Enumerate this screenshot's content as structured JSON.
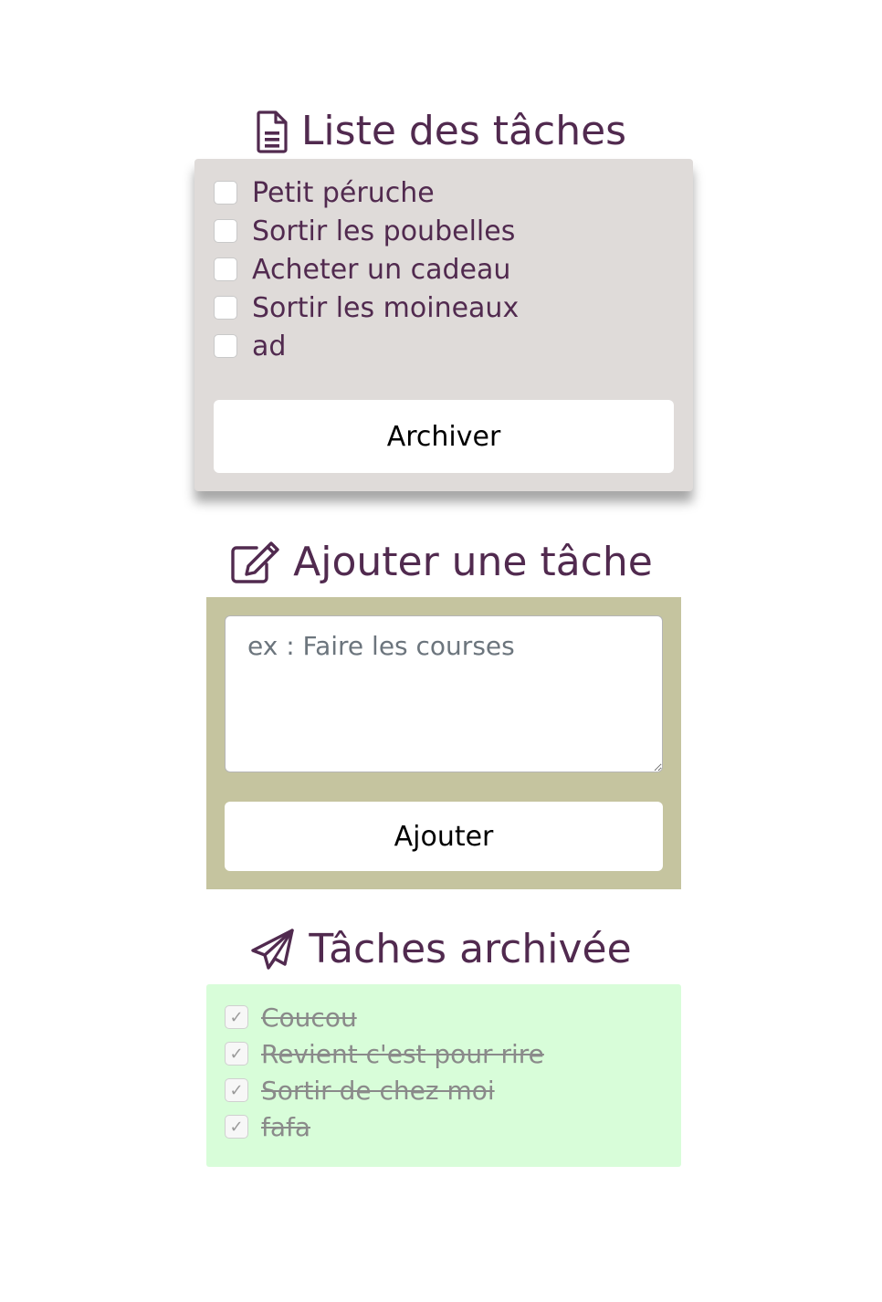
{
  "colors": {
    "title": "#512a4f",
    "list_panel": "#dfdbd9",
    "add_panel": "#c5c49f",
    "archived_panel": "#d8fdd9"
  },
  "task_list": {
    "title": "Liste des tâches",
    "icon": "file-text-icon",
    "items": [
      {
        "label": "Petit péruche",
        "checked": false
      },
      {
        "label": "Sortir les poubelles",
        "checked": false
      },
      {
        "label": "Acheter un cadeau",
        "checked": false
      },
      {
        "label": "Sortir les moineaux",
        "checked": false
      },
      {
        "label": "ad",
        "checked": false
      }
    ],
    "archive_label": "Archiver"
  },
  "add_task": {
    "title": "Ajouter une tâche",
    "icon": "edit-icon",
    "placeholder": "ex : Faire les courses",
    "value": "",
    "add_label": "Ajouter"
  },
  "archived": {
    "title": "Tâches archivée",
    "icon": "paper-plane-icon",
    "items": [
      {
        "label": "Coucou",
        "checked": true
      },
      {
        "label": "Revient c'est pour rire",
        "checked": true
      },
      {
        "label": "Sortir de chez moi",
        "checked": true
      },
      {
        "label": "fafa",
        "checked": true
      }
    ]
  }
}
